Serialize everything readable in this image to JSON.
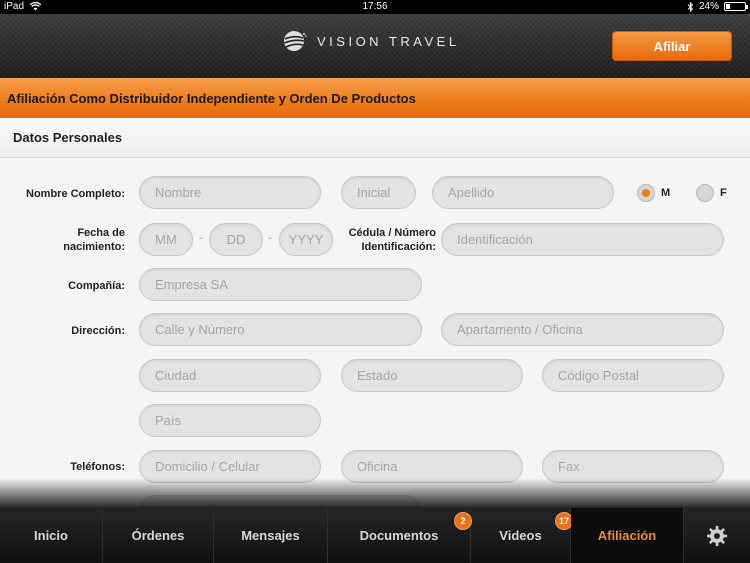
{
  "status_bar": {
    "device": "iPad",
    "time": "17:56",
    "battery": "24%",
    "battery_level": 0.24
  },
  "header": {
    "brand": "VISION TRAVEL",
    "afiliar_button": "Afiliar"
  },
  "title_bar": "Afiliación Como Distribuidor Independiente y Orden De Productos",
  "section_title": "Datos Personales",
  "form": {
    "nombre_label": "Nombre Completo:",
    "nombre_placeholder": "Nombre",
    "inicial_placeholder": "Inicial",
    "apellido_placeholder": "Apellido",
    "gender_m": "M",
    "gender_f": "F",
    "gender_selected": "M",
    "fecha_label_1": "Fecha de",
    "fecha_label_2": "nacimiento:",
    "mm_placeholder": "MM",
    "dd_placeholder": "DD",
    "yyyy_placeholder": "YYYY",
    "dash": "-",
    "cedula_label_1": "Cédula / Número",
    "cedula_label_2": "Identificación:",
    "identificacion_placeholder": "Identificación",
    "compania_label": "Compañía:",
    "empresa_placeholder": "Empresa SA",
    "direccion_label": "Dirección:",
    "calle_placeholder": "Calle y Número",
    "apartamento_placeholder": "Apartamento / Oficina",
    "ciudad_placeholder": "Ciudad",
    "estado_placeholder": "Estado",
    "codigo_postal_placeholder": "Código Postal",
    "pais_placeholder": "País",
    "telefonos_label": "Teléfonos:",
    "domicilio_placeholder": "Domicilio / Celular",
    "oficina_placeholder": "Oficina",
    "fax_placeholder": "Fax"
  },
  "tabs": [
    {
      "label": "Inicio"
    },
    {
      "label": "Órdenes"
    },
    {
      "label": "Mensajes"
    },
    {
      "label": "Documentos",
      "badge": "2"
    },
    {
      "label": "Videos",
      "badge": "17"
    },
    {
      "label": "Afiliación",
      "active": true
    }
  ],
  "colors": {
    "accent": "#ee7a1a",
    "header_bg": "#222222",
    "field_bg": "#e3e3e3"
  }
}
